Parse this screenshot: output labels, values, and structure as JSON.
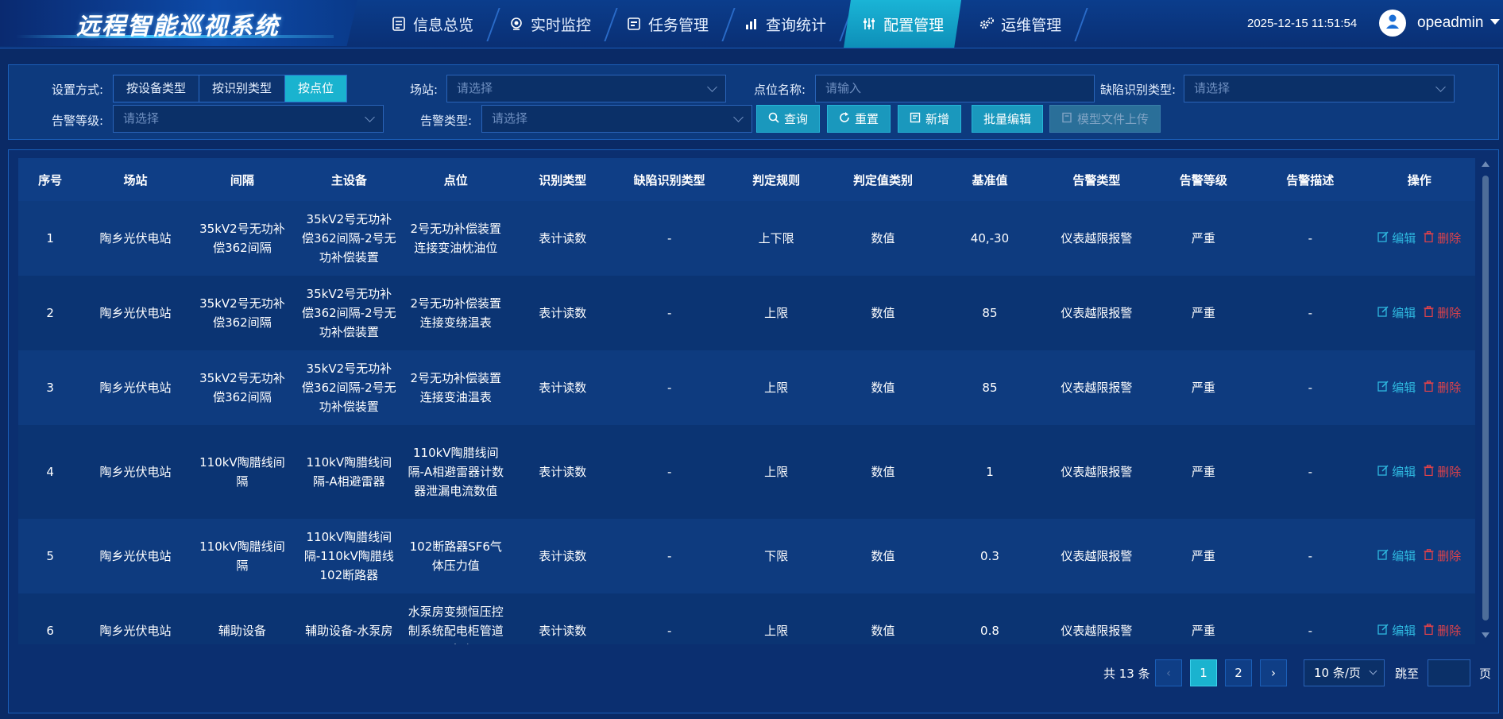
{
  "header": {
    "title": "远程智能巡视系统",
    "nav": [
      {
        "label": "信息总览",
        "icon": "info-icon"
      },
      {
        "label": "实时监控",
        "icon": "camera-icon"
      },
      {
        "label": "任务管理",
        "icon": "task-icon"
      },
      {
        "label": "查询统计",
        "icon": "chart-icon"
      },
      {
        "label": "配置管理",
        "icon": "sliders-icon",
        "active": true
      },
      {
        "label": "运维管理",
        "icon": "gears-icon"
      }
    ],
    "datetime": "2025-12-15 11:51:54",
    "username": "opeadmin"
  },
  "filters": {
    "mode_label": "设置方式:",
    "modes": [
      "按设备类型",
      "按识别类型",
      "按点位"
    ],
    "active_mode": "按点位",
    "station_label": "场站:",
    "station_placeholder": "请选择",
    "point_name_label": "点位名称:",
    "point_name_placeholder": "请输入",
    "defect_type_label": "缺陷识别类型:",
    "defect_type_placeholder": "请选择",
    "alarm_level_label": "告警等级:",
    "alarm_level_placeholder": "请选择",
    "alarm_type_label": "告警类型:",
    "alarm_type_placeholder": "请选择",
    "buttons": {
      "query": "查询",
      "reset": "重置",
      "add": "新增",
      "batch_edit": "批量编辑",
      "upload_model": "模型文件上传"
    }
  },
  "table": {
    "columns": [
      "序号",
      "场站",
      "间隔",
      "主设备",
      "点位",
      "识别类型",
      "缺陷识别类型",
      "判定规则",
      "判定值类别",
      "基准值",
      "告警类型",
      "告警等级",
      "告警描述",
      "操作"
    ],
    "rows": [
      {
        "no": "1",
        "station": "陶乡光伏电站",
        "bay": "35kV2号无功补偿362间隔",
        "device": "35kV2号无功补偿362间隔-2号无功补偿装置",
        "point": "2号无功补偿装置连接变油枕油位",
        "recog": "表计读数",
        "defect": "-",
        "rule": "上下限",
        "value_cat": "数值",
        "baseline": "40,-30",
        "alarm_type": "仪表越限报警",
        "alarm_level": "严重",
        "alarm_desc": "-"
      },
      {
        "no": "2",
        "station": "陶乡光伏电站",
        "bay": "35kV2号无功补偿362间隔",
        "device": "35kV2号无功补偿362间隔-2号无功补偿装置",
        "point": "2号无功补偿装置连接变绕温表",
        "recog": "表计读数",
        "defect": "-",
        "rule": "上限",
        "value_cat": "数值",
        "baseline": "85",
        "alarm_type": "仪表越限报警",
        "alarm_level": "严重",
        "alarm_desc": "-"
      },
      {
        "no": "3",
        "station": "陶乡光伏电站",
        "bay": "35kV2号无功补偿362间隔",
        "device": "35kV2号无功补偿362间隔-2号无功补偿装置",
        "point": "2号无功补偿装置连接变油温表",
        "recog": "表计读数",
        "defect": "-",
        "rule": "上限",
        "value_cat": "数值",
        "baseline": "85",
        "alarm_type": "仪表越限报警",
        "alarm_level": "严重",
        "alarm_desc": "-"
      },
      {
        "no": "4",
        "station": "陶乡光伏电站",
        "bay": "110kV陶腊线间隔",
        "device": "110kV陶腊线间隔-A相避雷器",
        "point": "110kV陶腊线间隔-A相避雷器计数器泄漏电流数值",
        "recog": "表计读数",
        "defect": "-",
        "rule": "上限",
        "value_cat": "数值",
        "baseline": "1",
        "alarm_type": "仪表越限报警",
        "alarm_level": "严重",
        "alarm_desc": "-"
      },
      {
        "no": "5",
        "station": "陶乡光伏电站",
        "bay": "110kV陶腊线间隔",
        "device": "110kV陶腊线间隔-110kV陶腊线102断路器",
        "point": "102断路器SF6气体压力值",
        "recog": "表计读数",
        "defect": "-",
        "rule": "下限",
        "value_cat": "数值",
        "baseline": "0.3",
        "alarm_type": "仪表越限报警",
        "alarm_level": "严重",
        "alarm_desc": "-"
      },
      {
        "no": "6",
        "station": "陶乡光伏电站",
        "bay": "辅助设备",
        "device": "辅助设备-水泵房",
        "point": "水泵房变频恒压控制系统配电柜管道压力表",
        "recog": "表计读数",
        "defect": "-",
        "rule": "上限",
        "value_cat": "数值",
        "baseline": "0.8",
        "alarm_type": "仪表越限报警",
        "alarm_level": "严重",
        "alarm_desc": "-"
      }
    ],
    "ops": {
      "edit": "编辑",
      "delete": "删除"
    }
  },
  "pagination": {
    "total_text": "共 13 条",
    "pages": [
      "1",
      "2"
    ],
    "current": "1",
    "page_size": "10 条/页",
    "jump_label": "跳至",
    "page_label": "页"
  },
  "colors": {
    "accent": "#1ab3cf",
    "danger": "#e0424a",
    "link": "#2fb9e0",
    "background": "#0a2a66"
  }
}
